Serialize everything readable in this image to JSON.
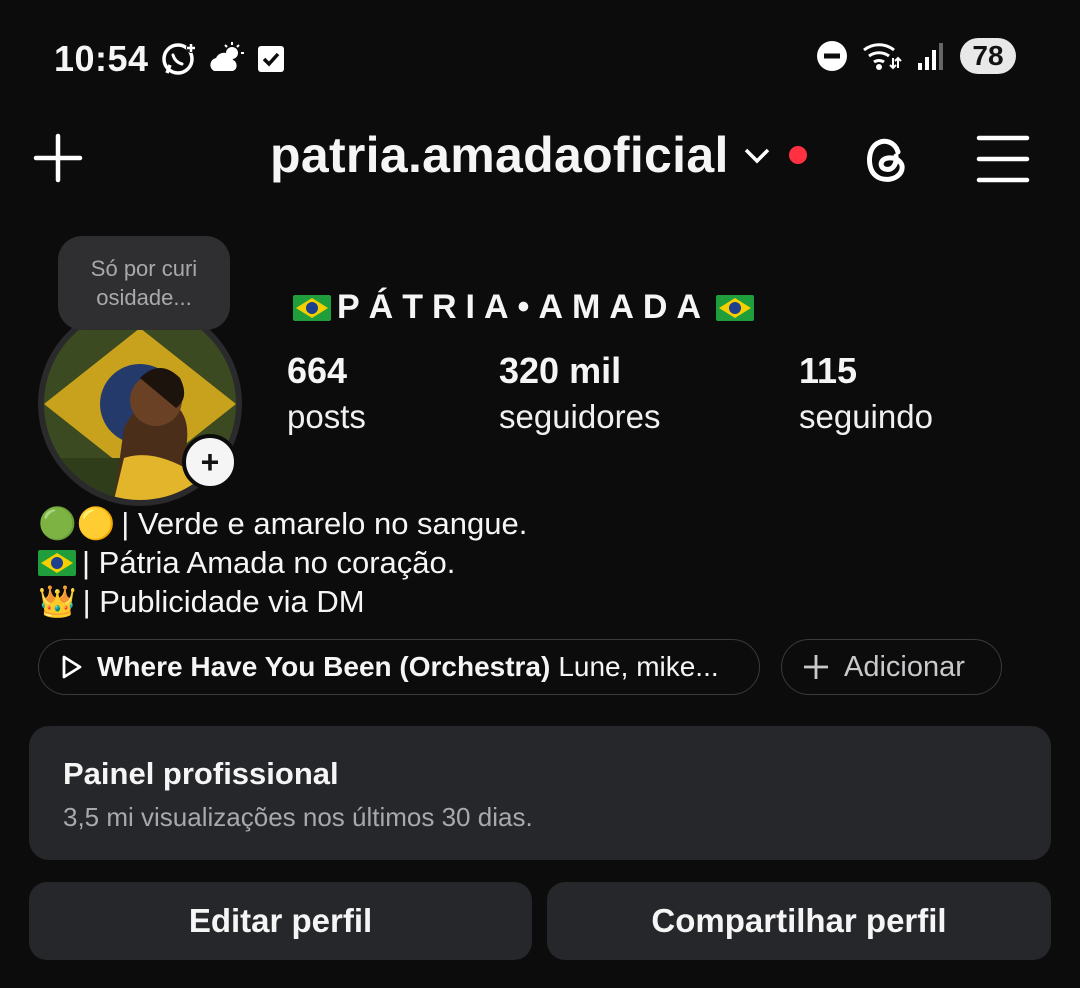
{
  "status_bar": {
    "time": "10:54",
    "battery": "78",
    "icons_left": [
      "whatsapp-icon",
      "weather-icon",
      "checkbox-icon"
    ],
    "icons_right": [
      "dnd-icon",
      "wifi-icon",
      "signal-icon"
    ]
  },
  "header": {
    "username": "patria.amadaoficial",
    "has_notification_dot": true,
    "notification_color": "#ff3040"
  },
  "profile": {
    "note": "Só por curi osidade...",
    "display_name": "PÁTRIA•AMADA",
    "stats": [
      {
        "value": "664",
        "label": "posts"
      },
      {
        "value": "320 mil",
        "label": "seguidores"
      },
      {
        "value": "115",
        "label": "seguindo"
      }
    ],
    "bio": [
      {
        "emoji": "🟢🟡",
        "text": "| Verde e amarelo no sangue."
      },
      {
        "emoji": "brazil-flag",
        "text": "| Pátria Amada no coração."
      },
      {
        "emoji": "👑",
        "text": "| Publicidade via DM"
      }
    ]
  },
  "music": {
    "title": "Where Have You Been (Orchestra)",
    "artist": "Lune, mike..."
  },
  "add_chip": {
    "label": "Adicionar"
  },
  "dashboard": {
    "title": "Painel profissional",
    "subtitle": "3,5 mi visualizações nos últimos 30 dias."
  },
  "buttons": {
    "edit": "Editar perfil",
    "share": "Compartilhar perfil"
  }
}
